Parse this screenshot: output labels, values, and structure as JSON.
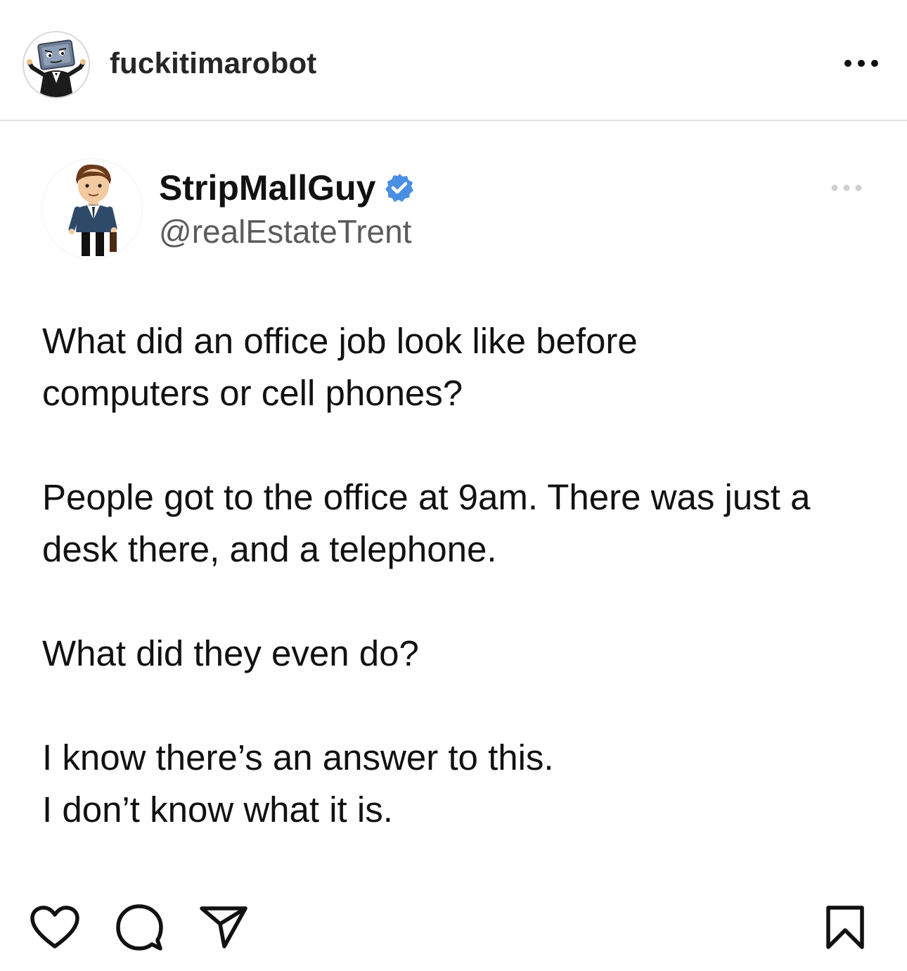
{
  "ig_header": {
    "username": "fuckitimarobot",
    "avatar_icon": "robot-avatar-icon",
    "more_icon": "more-horizontal-icon"
  },
  "tweet": {
    "display_name": "StripMallGuy",
    "verified": true,
    "verified_color": "#4a90e2",
    "handle": "@realEstateTrent",
    "more_icon": "more-horizontal-icon",
    "paragraphs": [
      [
        "What did an office job look like before",
        "computers or cell phones?"
      ],
      [
        "People got to the office at 9am. There was just a",
        "desk there, and a telephone."
      ],
      [
        "What did they even do?"
      ],
      [
        "I know there’s an answer to this.",
        "I don’t know what it is."
      ]
    ]
  },
  "actions": {
    "like_icon": "heart-icon",
    "comment_icon": "comment-icon",
    "share_icon": "send-icon",
    "save_icon": "bookmark-icon"
  }
}
